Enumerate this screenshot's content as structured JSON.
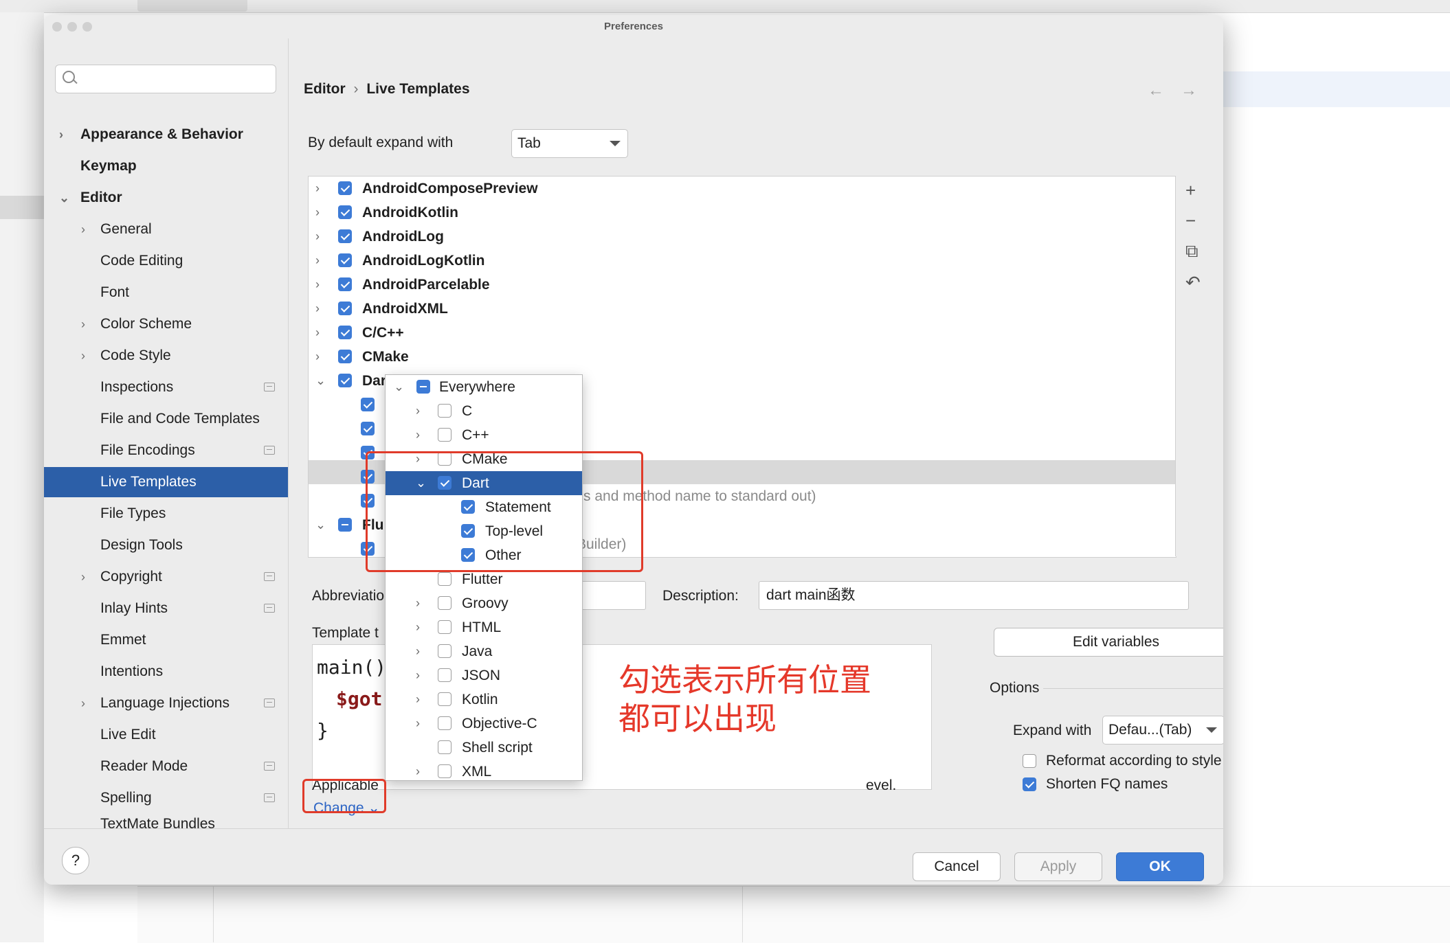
{
  "dialog": {
    "title": "Preferences"
  },
  "sidebar": {
    "search_placeholder": "",
    "items": [
      {
        "label": "Appearance & Behavior",
        "chevron": "›"
      },
      {
        "label": "Keymap"
      },
      {
        "label": "Editor",
        "chevron": "⌄"
      },
      {
        "label": "General",
        "chevron": "›"
      },
      {
        "label": "Code Editing"
      },
      {
        "label": "Font"
      },
      {
        "label": "Color Scheme",
        "chevron": "›"
      },
      {
        "label": "Code Style",
        "chevron": "›"
      },
      {
        "label": "Inspections"
      },
      {
        "label": "File and Code Templates"
      },
      {
        "label": "File Encodings"
      },
      {
        "label": "Live Templates"
      },
      {
        "label": "File Types"
      },
      {
        "label": "Design Tools"
      },
      {
        "label": "Copyright",
        "chevron": "›"
      },
      {
        "label": "Inlay Hints"
      },
      {
        "label": "Emmet"
      },
      {
        "label": "Intentions"
      },
      {
        "label": "Language Injections",
        "chevron": "›"
      },
      {
        "label": "Live Edit"
      },
      {
        "label": "Reader Mode"
      },
      {
        "label": "Spelling"
      },
      {
        "label": "TextMate Bundles"
      }
    ]
  },
  "header": {
    "crumb_parent": "Editor",
    "crumb_sep": "›",
    "crumb_current": "Live Templates",
    "back": "←",
    "forward": "→"
  },
  "expand": {
    "label": "By default expand with",
    "value": "Tab"
  },
  "template_groups": [
    {
      "label": "AndroidComposePreview",
      "chevron": "›"
    },
    {
      "label": "AndroidKotlin",
      "chevron": "›"
    },
    {
      "label": "AndroidLog",
      "chevron": "›"
    },
    {
      "label": "AndroidLogKotlin",
      "chevron": "›"
    },
    {
      "label": "AndroidParcelable",
      "chevron": "›"
    },
    {
      "label": "AndroidXML",
      "chevron": "›"
    },
    {
      "label": "C/C++",
      "chevron": "›"
    },
    {
      "label": "CMake",
      "chevron": "›"
    },
    {
      "label": "Dart",
      "chevron": "⌄"
    },
    {
      "label": "Flu",
      "chevron": "⌄"
    }
  ],
  "tree_fragments": {
    "row5": "s and method name to standard out)",
    "row7": "Builder)"
  },
  "toolbar": {
    "add": "+",
    "remove": "−",
    "copy": "⧉",
    "restore": "↶"
  },
  "editor_fields": {
    "abbreviation_label": "Abbreviatio",
    "description_label": "Description:",
    "description_value": "dart main函数",
    "template_text_label": "Template t",
    "code_line1": "main(){",
    "code_line2": "$got",
    "code_line3": "}",
    "applicable_label": "Applicable",
    "applicable_suffix": "evel.",
    "change_link": "Change ⌄"
  },
  "edit_variables": "Edit variables",
  "options": {
    "title": "Options",
    "expand_label": "Expand with",
    "expand_value": "Defau...(Tab)",
    "reformat_label": "Reformat according to style",
    "shorten_label": "Shorten FQ names"
  },
  "popup": {
    "rows": [
      {
        "label": "Everywhere",
        "chevron": "⌄"
      },
      {
        "label": "C",
        "chevron": "›"
      },
      {
        "label": "C++",
        "chevron": "›"
      },
      {
        "label": "CMake",
        "chevron": "›"
      },
      {
        "label": "Dart",
        "chevron": "⌄"
      },
      {
        "label": "Statement"
      },
      {
        "label": "Top-level"
      },
      {
        "label": "Other"
      },
      {
        "label": "Flutter"
      },
      {
        "label": "Groovy",
        "chevron": "›"
      },
      {
        "label": "HTML",
        "chevron": "›"
      },
      {
        "label": "Java",
        "chevron": "›"
      },
      {
        "label": "JSON",
        "chevron": "›"
      },
      {
        "label": "Kotlin",
        "chevron": "›"
      },
      {
        "label": "Objective-C",
        "chevron": "›"
      },
      {
        "label": "Shell script"
      },
      {
        "label": "XML",
        "chevron": "›"
      }
    ]
  },
  "annotation": {
    "line1": "勾选表示所有位置",
    "line2": "都可以出现"
  },
  "buttons": {
    "help": "?",
    "cancel": "Cancel",
    "apply": "Apply",
    "ok": "OK"
  },
  "colors": {
    "accent": "#3d7bd6",
    "selection": "#2c5fa8",
    "annotation": "#e5382a"
  }
}
